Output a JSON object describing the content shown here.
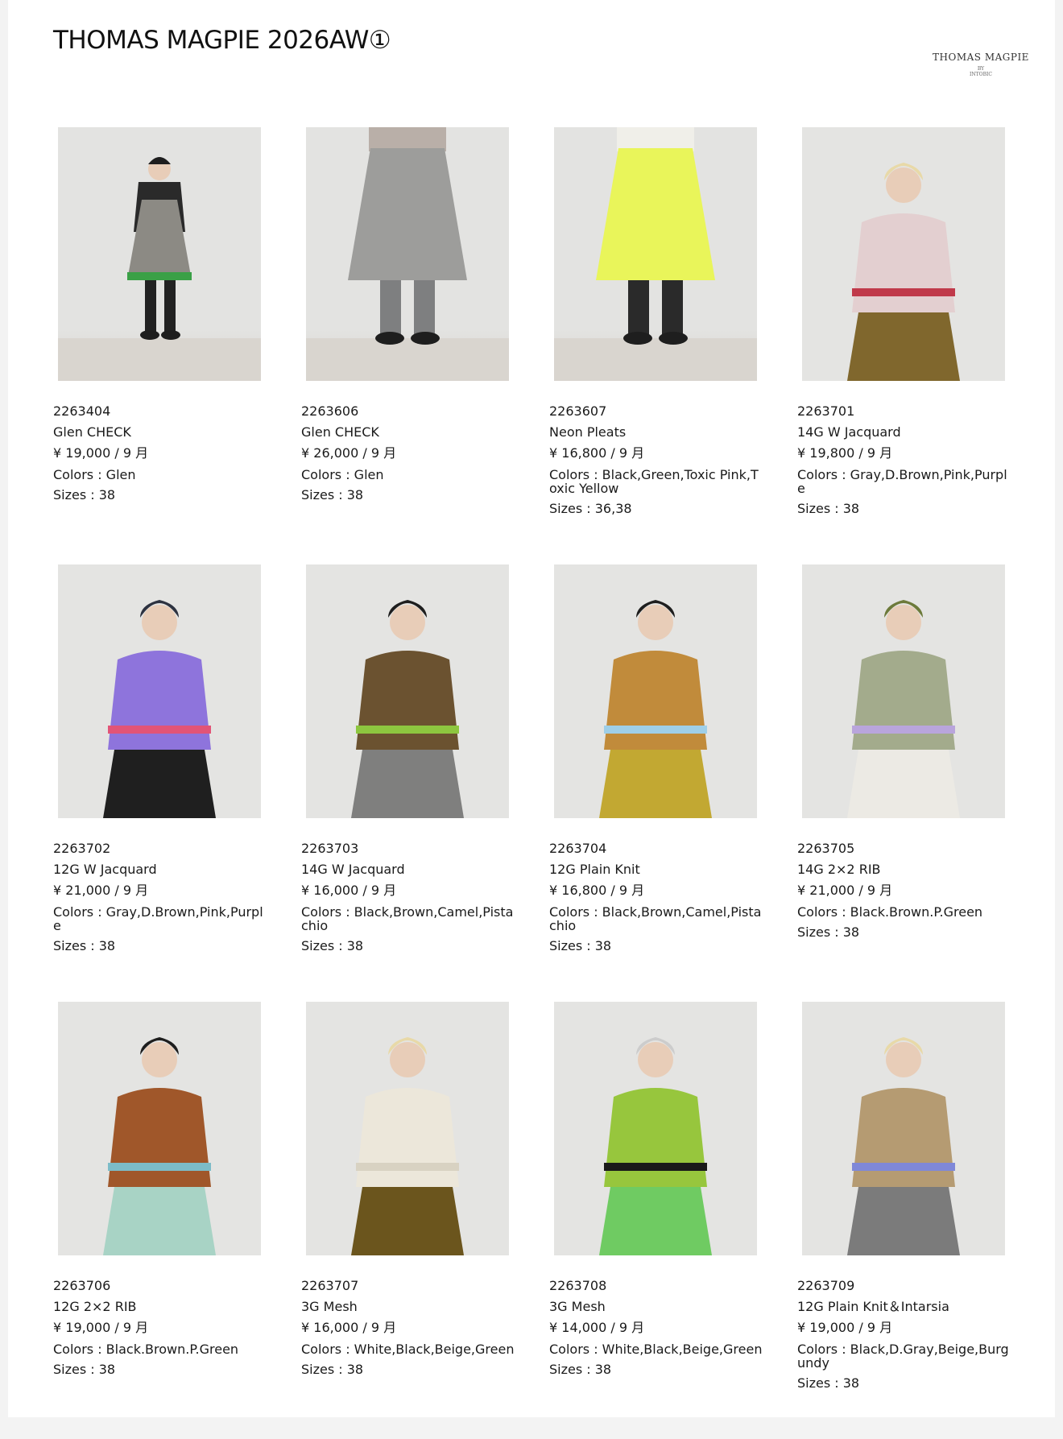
{
  "page_title": "THOMAS MAGPIE 2026AW①",
  "logo": {
    "line1": "THOMAS MAGPIE",
    "line2": "BY",
    "line3": "INTOBIC"
  },
  "labels": {
    "colors_prefix": "Colors : ",
    "sizes_prefix": "Sizes : "
  },
  "products": [
    {
      "code": "2263404",
      "name": "Glen CHECK",
      "price": "¥ 19,000 /  9 月",
      "colors": "Glen",
      "sizes": "38",
      "photo": {
        "top": "#2a2a2a",
        "main": "#8c8a84",
        "bottom": "#222222",
        "hair": "#1e1e1e",
        "accent": "#3aa046",
        "type": "dress"
      }
    },
    {
      "code": "2263606",
      "name": "Glen CHECK",
      "price": "¥ 26,000 /  9 月",
      "colors": "Glen",
      "sizes": "38",
      "photo": {
        "top": "#b9afa8",
        "main": "#9d9d9b",
        "bottom": "#7e7f80",
        "hair": "#1e1e1e",
        "accent": "#7a5c1e",
        "type": "skirt"
      }
    },
    {
      "code": "2263607",
      "name": "Neon Pleats",
      "price": "¥ 16,800 /  9 月",
      "colors": "Black,Green,Toxic Pink,Toxic Yellow",
      "sizes": "36,38",
      "photo": {
        "top": "#f0efe9",
        "main": "#e9f55a",
        "bottom": "#2a2a2a",
        "hair": "#1e1e1e",
        "accent": "#d8f040",
        "type": "skirt"
      }
    },
    {
      "code": "2263701",
      "name": "14G W Jacquard",
      "price": "¥ 19,800 /  9 月",
      "colors": "Gray,D.Brown,Pink,Purple",
      "sizes": "38",
      "photo": {
        "top": "#e6d4d4",
        "main": "#e3cfd0",
        "bottom": "#80672d",
        "hair": "#e8d9a8",
        "accent": "#c0394a",
        "type": "top"
      }
    },
    {
      "code": "2263702",
      "name": "12G W Jacquard",
      "price": "¥ 21,000 /  9 月",
      "colors": "Gray,D.Brown,Pink,Purple",
      "sizes": "38",
      "photo": {
        "top": "#9073dd",
        "main": "#8e74dc",
        "bottom": "#1f1f1f",
        "hair": "#2d3240",
        "accent": "#e25477",
        "type": "top"
      }
    },
    {
      "code": "2263703",
      "name": "14G W Jacquard",
      "price": "¥ 16,000 /  9 月",
      "colors": "Black,Brown,Camel,Pistachio",
      "sizes": "38",
      "photo": {
        "top": "#6d5532",
        "main": "#6b5230",
        "bottom": "#7f7f7e",
        "hair": "#1e1e1e",
        "accent": "#8dc63f",
        "type": "top"
      }
    },
    {
      "code": "2263704",
      "name": "12G Plain Knit",
      "price": "¥ 16,800 /  9 月",
      "colors": "Black,Brown,Camel,Pistachio",
      "sizes": "38",
      "photo": {
        "top": "#c38d3d",
        "main": "#c18b3b",
        "bottom": "#c2a832",
        "hair": "#1e1e1e",
        "accent": "#9fcfe8",
        "type": "top"
      }
    },
    {
      "code": "2263705",
      "name": "14G 2×2 RIB",
      "price": "¥ 21,000 /  9 月",
      "colors": "Black.Brown.P.Green",
      "sizes": "38",
      "photo": {
        "top": "#a7ae90",
        "main": "#a3ab8c",
        "bottom": "#eceae4",
        "hair": "#6d7a3a",
        "accent": "#b9a5dc",
        "type": "top"
      }
    },
    {
      "code": "2263706",
      "name": "12G 2×2 RIB",
      "price": "¥ 19,000 /  9 月",
      "colors": "Black.Brown.P.Green",
      "sizes": "38",
      "photo": {
        "top": "#a2592a",
        "main": "#a0572a",
        "bottom": "#a8d3c5",
        "hair": "#1e1e1e",
        "accent": "#7cbcc8",
        "type": "top"
      }
    },
    {
      "code": "2263707",
      "name": "3G Mesh",
      "price": "¥ 16,000 /  9 月",
      "colors": "White,Black,Beige,Green",
      "sizes": "38",
      "photo": {
        "top": "#eeeadf",
        "main": "#ece7da",
        "bottom": "#6b551d",
        "hair": "#e8d9a8",
        "accent": "#d8d2c2",
        "type": "top"
      }
    },
    {
      "code": "2263708",
      "name": "3G Mesh",
      "price": "¥ 14,000 /  9 月",
      "colors": "White,Black,Beige,Green",
      "sizes": "38",
      "photo": {
        "top": "#f6f6f4",
        "main": "#97c63d",
        "bottom": "#6fcb62",
        "hair": "#cccccc",
        "accent": "#1a1a1a",
        "type": "top"
      }
    },
    {
      "code": "2263709",
      "name": "12G Plain Knit＆Intarsia",
      "price": "¥ 19,000 /  9 月",
      "colors": "Black,D.Gray,Beige,Burgundy",
      "sizes": "38",
      "photo": {
        "top": "#f4f4f2",
        "main": "#b59b72",
        "bottom": "#7b7b7b",
        "hair": "#e8d9a8",
        "accent": "#7f88d8",
        "type": "back"
      }
    }
  ]
}
